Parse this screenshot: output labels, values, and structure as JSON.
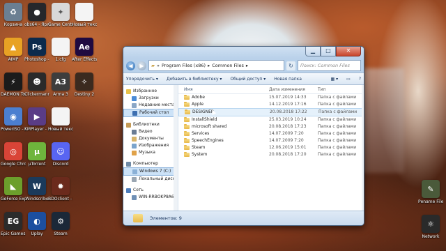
{
  "desktop": {
    "icons": [
      {
        "name": "recycle-bin-icon",
        "label": "Корзина",
        "glyph": "♻",
        "color": "#6b7f92",
        "col": 0,
        "row": 0
      },
      {
        "name": "obs-shortcut-icon",
        "label": "obs64 - Ярлык",
        "glyph": "●",
        "color": "#26272b",
        "col": 1,
        "row": 0
      },
      {
        "name": "game-center-icon",
        "label": "Game Center",
        "glyph": "✦",
        "color": "#d8d8d8",
        "col": 2,
        "row": 0
      },
      {
        "name": "new-text-doc-icon",
        "label": "Новый текстовый",
        "glyph": "",
        "color": "#f4f4f4",
        "col": 3,
        "row": 0
      },
      {
        "name": "aimp-icon",
        "label": "AIMP",
        "glyph": "▲",
        "color": "#e8a224",
        "col": 0,
        "row": 1
      },
      {
        "name": "photoshop-icon",
        "label": "Photoshop - Ярлык",
        "glyph": "Ps",
        "color": "#0c2a4c",
        "col": 1,
        "row": 1
      },
      {
        "name": "cfg-file-icon",
        "label": "1.cfg",
        "glyph": "",
        "color": "#f4f4f4",
        "col": 2,
        "row": 1
      },
      {
        "name": "after-effects-icon",
        "label": "After Effects",
        "glyph": "Ae",
        "color": "#1f0a40",
        "col": 3,
        "row": 1
      },
      {
        "name": "daemon-tools-icon",
        "label": "DAEMON Tools Lite",
        "glyph": "⚡",
        "color": "#1b1b1b",
        "col": 0,
        "row": 2
      },
      {
        "name": "clickermann-icon",
        "label": "Clickermann - Ярлык",
        "glyph": "☻",
        "color": "#2a2a2a",
        "col": 1,
        "row": 2
      },
      {
        "name": "arma3-icon",
        "label": "Arma 3",
        "glyph": "A3",
        "color": "#3d3d3d",
        "col": 2,
        "row": 2
      },
      {
        "name": "destiny2-icon",
        "label": "Destiny 2",
        "glyph": "✧",
        "color": "#3b2a1f",
        "col": 3,
        "row": 2
      },
      {
        "name": "poweriso-icon",
        "label": "PowerISO - Ярлык",
        "glyph": "◉",
        "color": "#4b7fd0",
        "col": 0,
        "row": 3
      },
      {
        "name": "kmplayer-icon",
        "label": "KMPlayer - Ярлык",
        "glyph": "▶",
        "color": "#5a3c86",
        "col": 1,
        "row": 3
      },
      {
        "name": "new-text-doc-2-icon",
        "label": "Новый текстовый",
        "glyph": "",
        "color": "#f4f4f4",
        "col": 2,
        "row": 3
      },
      {
        "name": "google-chrome-icon",
        "label": "Google Chrome",
        "glyph": "◎",
        "color": "#d94437",
        "col": 0,
        "row": 4
      },
      {
        "name": "utorrent-icon",
        "label": "µTorrent",
        "glyph": "µ",
        "color": "#6eb53c",
        "col": 1,
        "row": 4
      },
      {
        "name": "discord-icon",
        "label": "Discord",
        "glyph": "☺",
        "color": "#5865f2",
        "col": 2,
        "row": 4
      },
      {
        "name": "geforce-experience-icon",
        "label": "GeForce Experience",
        "glyph": "◣",
        "color": "#6c9f2c",
        "col": 0,
        "row": 5
      },
      {
        "name": "windscribe-icon",
        "label": "Windscribe",
        "glyph": "W",
        "color": "#1b3a5b",
        "col": 1,
        "row": 5
      },
      {
        "name": "bdoclient-icon",
        "label": "BDOclient - Ярлык",
        "glyph": "✹",
        "color": "#6b2a1c",
        "col": 2,
        "row": 5
      },
      {
        "name": "epic-games-icon",
        "label": "Epic Games Launcher",
        "glyph": "EG",
        "color": "#2b2b2b",
        "col": 0,
        "row": 6
      },
      {
        "name": "uplay-icon",
        "label": "Uplay",
        "glyph": "◐",
        "color": "#1c4fa0",
        "col": 1,
        "row": 6
      },
      {
        "name": "steam-icon",
        "label": "Steam",
        "glyph": "⚙",
        "color": "#1b2838",
        "col": 2,
        "row": 6
      }
    ],
    "right_icons": [
      {
        "name": "rename-file-icon",
        "label": "Рename File",
        "glyph": "✎",
        "color": "#4a5a3a"
      },
      {
        "name": "network-icon",
        "label": "Network",
        "glyph": "⚛",
        "color": "#2a2a2a"
      }
    ]
  },
  "explorer": {
    "address_segments": [
      "Program Files (x86)",
      "Common Files"
    ],
    "search_placeholder": "Поиск: Common Files",
    "toolbar": {
      "organize": "Упорядочить ▾",
      "add_to_library": "Добавить в библиотеку ▾",
      "share": "Общий доступ ▾",
      "new_folder": "Новая папка"
    },
    "nav_pane": [
      {
        "label": "Избранное",
        "color": "#e8c24a",
        "indent": 0
      },
      {
        "label": "Загрузки",
        "color": "#4a8bd6",
        "indent": 1
      },
      {
        "label": "Недавние места",
        "color": "#8aa6c6",
        "indent": 1
      },
      {
        "label": "Рабочий стол",
        "color": "#3d6fb0",
        "indent": 1,
        "selected": true
      },
      {
        "label": "",
        "color": "",
        "indent": 0,
        "spacer": true
      },
      {
        "label": "Библиотеки",
        "color": "#c49a56",
        "indent": 0
      },
      {
        "label": "Видео",
        "color": "#6a7c94",
        "indent": 1
      },
      {
        "label": "Документы",
        "color": "#d7b46a",
        "indent": 1
      },
      {
        "label": "Изображения",
        "color": "#7aa4cd",
        "indent": 1
      },
      {
        "label": "Музыка",
        "color": "#e0a24a",
        "indent": 1
      },
      {
        "label": "",
        "color": "",
        "indent": 0,
        "spacer": true
      },
      {
        "label": "Компьютер",
        "color": "#6f8aa6",
        "indent": 0
      },
      {
        "label": "Windows 7 (C:)",
        "color": "#8ab0d6",
        "indent": 1,
        "selected": true
      },
      {
        "label": "Локальный диск (D:)",
        "color": "#9aa6b2",
        "indent": 1
      },
      {
        "label": "",
        "color": "",
        "indent": 0,
        "spacer": true
      },
      {
        "label": "Сеть",
        "color": "#4d7dbb",
        "indent": 0
      },
      {
        "label": "WIN-RRBOKP8A6SQ",
        "color": "#6e8fb5",
        "indent": 1
      }
    ],
    "columns": {
      "name": "Имя",
      "date": "Дата изменения",
      "type": "Тип"
    },
    "files": [
      {
        "name": "Adobe",
        "date": "15.07.2019 14:33",
        "type": "Папка с файлами"
      },
      {
        "name": "Apple",
        "date": "14.12.2019 17:16",
        "type": "Папка с файлами"
      },
      {
        "name": "DESIGNER",
        "date": "20.08.2018 17:22",
        "type": "Папка с файлами",
        "hover": true
      },
      {
        "name": "InstallShield",
        "date": "25.03.2019 10:24",
        "type": "Папка с файлами"
      },
      {
        "name": "microsoft shared",
        "date": "20.08.2018 17:23",
        "type": "Папка с файлами"
      },
      {
        "name": "Services",
        "date": "14.07.2009 7:20",
        "type": "Папка с файлами"
      },
      {
        "name": "SpeechEngines",
        "date": "14.07.2009 7:20",
        "type": "Папка с файлами"
      },
      {
        "name": "Steam",
        "date": "12.06.2019 15:01",
        "type": "Папка с файлами"
      },
      {
        "name": "System",
        "date": "20.08.2018 17:20",
        "type": "Папка с файлами"
      }
    ],
    "status": "Элементов: 9"
  }
}
